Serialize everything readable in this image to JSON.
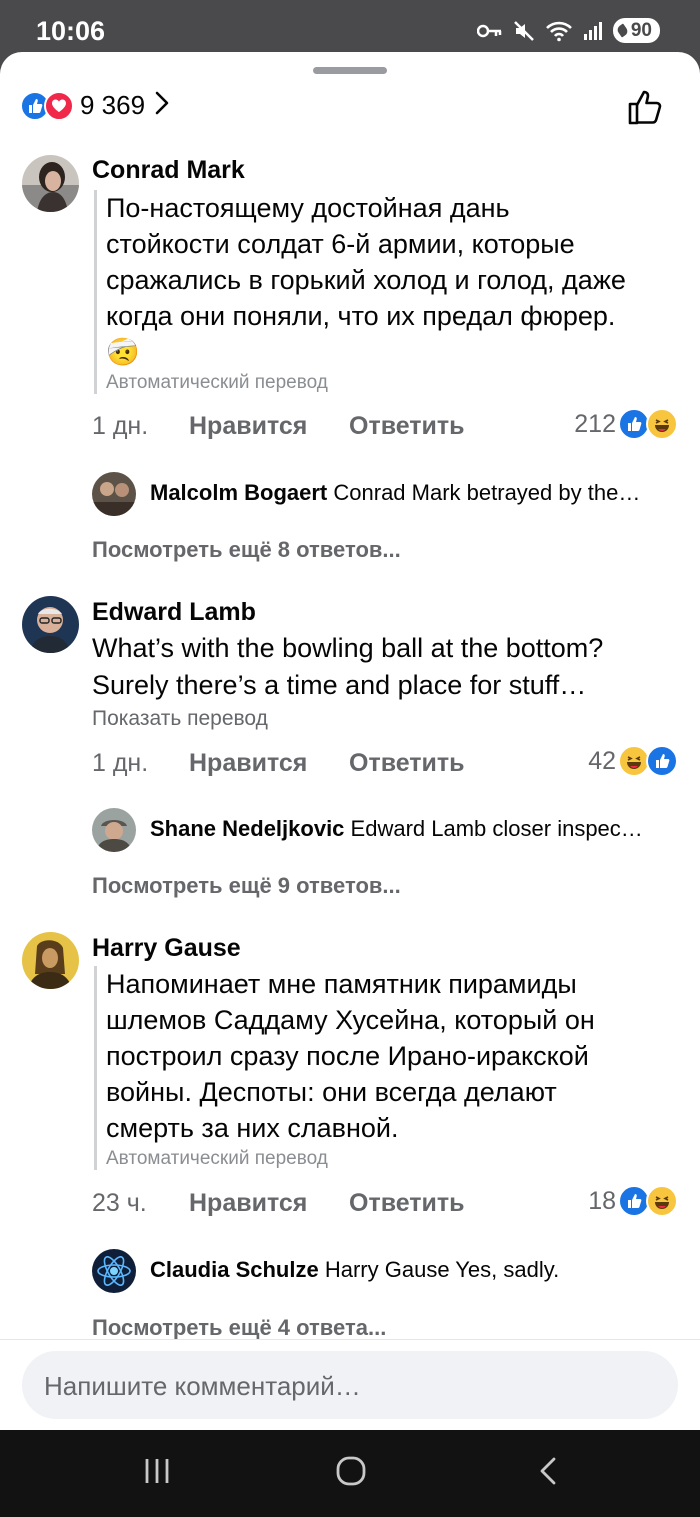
{
  "status_bar": {
    "time": "10:06",
    "battery": "90",
    "icons": [
      "vpn-key-icon",
      "mute-icon",
      "wifi-icon",
      "signal-icon",
      "battery-icon"
    ]
  },
  "post_reactions": {
    "count": "9 369",
    "icons": [
      "like-icon",
      "love-icon"
    ]
  },
  "comments": [
    {
      "author": "Conrad Mark",
      "text": "По-настоящему достойная дань стойкости солдат 6-й армии, которые сражались в горький холод и голод, даже когда они поняли, что их предал фюрер. 🤕",
      "note": "Автоматический перевод",
      "age": "1 дн.",
      "like_label": "Нравится",
      "reply_label": "Ответить",
      "reaction_count": "212",
      "reactions": [
        "like",
        "haha"
      ],
      "top_reply": {
        "author": "Malcolm Bogaert",
        "text": "Conrad Mark betrayed by the…"
      },
      "more_replies": "Посмотреть ещё 8 ответов..."
    },
    {
      "author": "Edward Lamb",
      "text": "What’s with the bowling ball at the bottom? Surely there’s a time and place for stuff…",
      "note": "Показать перевод",
      "age": "1 дн.",
      "like_label": "Нравится",
      "reply_label": "Ответить",
      "reaction_count": "42",
      "reactions": [
        "haha",
        "like"
      ],
      "top_reply": {
        "author": "Shane Nedeljkovic",
        "text": "Edward Lamb closer inspec…"
      },
      "more_replies": "Посмотреть ещё 9 ответов..."
    },
    {
      "author": "Harry Gause",
      "text": "Напоминает мне памятник пирамиды шлемов Саддаму Хусейна, который он построил сразу после Ирано-иракской войны. Деспоты: они всегда делают смерть за них славной.",
      "note": "Автоматический перевод",
      "age": "23 ч.",
      "like_label": "Нравится",
      "reply_label": "Ответить",
      "reaction_count": "18",
      "reactions": [
        "like",
        "haha"
      ],
      "top_reply": {
        "author": "Claudia Schulze",
        "text": "Harry Gause Yes, sadly."
      },
      "more_replies": "Посмотреть ещё 4 ответа..."
    }
  ],
  "composer": {
    "placeholder": "Напишите комментарий…"
  },
  "colors": {
    "like_blue": "#1b74e4",
    "love_red": "#f0284a",
    "haha_yellow": "#f7c53e",
    "secondary_text": "#65676b"
  },
  "nav_bar": {
    "icons": [
      "recent-apps-icon",
      "home-icon",
      "back-icon"
    ]
  }
}
